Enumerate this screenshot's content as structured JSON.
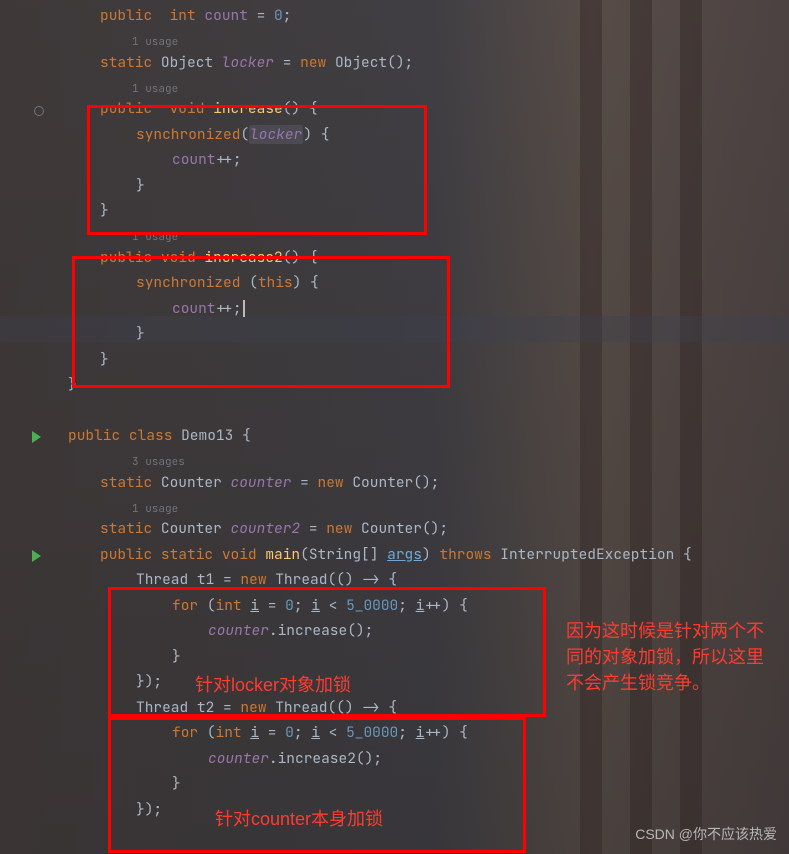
{
  "usages": {
    "one": "1 usage",
    "three": "3 usages"
  },
  "code": {
    "l1": {
      "pub": "public",
      "sp": "  ",
      "int_": "int",
      "count": "count",
      "eq": " = ",
      "zero": "0",
      "semi": ";"
    },
    "l3": {
      "stat": "static",
      "obj": "Object",
      "locker": "locker",
      "eq": " = ",
      "new_": "new",
      "obj2": "Object",
      "paren": "();"
    },
    "l5": {
      "pub": "public",
      "sp": "  ",
      "void_": "void",
      "name": "increase",
      "tail": "() {"
    },
    "l6": {
      "sync": "synchronized",
      "open": "(",
      "locker": "locker",
      "close": ") {"
    },
    "l7": {
      "count": "count",
      "pp": "++",
      "semi": ";"
    },
    "l8": {
      "brace": "}"
    },
    "l9": {
      "brace": "}"
    },
    "l11": {
      "pub": "public",
      "void_": "void",
      "name": "increase2",
      "tail": "() {"
    },
    "l12": {
      "sync": "synchronized",
      "open": " (",
      "this_": "this",
      "close": ") {"
    },
    "l13": {
      "count": "count",
      "pp": "++",
      "semi": ";"
    },
    "l14": {
      "brace": "}"
    },
    "l15": {
      "brace": "}"
    },
    "l16": {
      "brace": "}"
    },
    "l18": {
      "pub": "public",
      "cls": "class",
      "name": "Demo13",
      "tail": " {"
    },
    "l20": {
      "stat": "static",
      "cnt": "Counter",
      "var": "counter",
      "eq": " = ",
      "new_": "new",
      "cnt2": "Counter",
      "tail": "();"
    },
    "l22": {
      "stat": "static",
      "cnt": "Counter",
      "var": "counter2",
      "eq": " = ",
      "new_": "new",
      "cnt2": "Counter",
      "tail": "();"
    },
    "l23": {
      "pub": "public",
      "stat": "static",
      "void_": "void",
      "main": "main",
      "open": "(",
      "str": "String[]",
      "args": "args",
      "close": ")",
      "throws_": "throws",
      "exc": "InterruptedException",
      "tail": " {"
    },
    "l24": {
      "thr": "Thread",
      "t1": "t1",
      "eq": " = ",
      "new_": "new",
      "thr2": "Thread",
      "lam": "(() -> {"
    },
    "l25": {
      "for_": "for",
      "open": " (",
      "int_": "int",
      "i": "i",
      "eq": " = ",
      "zero": "0",
      "semi1": "; ",
      "i2": "i",
      "lt": " < ",
      "lim": "5_0000",
      "semi2": "; ",
      "i3": "i",
      "pp": "++",
      "close": ") {"
    },
    "l26": {
      "ctr": "counter",
      "dot": ".",
      "call": "increase",
      "tail": "();"
    },
    "l27": {
      "brace": "}"
    },
    "l28": {
      "tail": "});"
    },
    "l29": {
      "thr": "Thread",
      "t2": "t2",
      "eq": " = ",
      "new_": "new",
      "thr2": "Thread",
      "lam": "(() -> {"
    },
    "l30": {
      "for_": "for",
      "open": " (",
      "int_": "int",
      "i": "i",
      "eq": " = ",
      "zero": "0",
      "semi1": "; ",
      "i2": "i",
      "lt": " < ",
      "lim": "5_0000",
      "semi2": "; ",
      "i3": "i",
      "pp": "++",
      "close": ") {"
    },
    "l31": {
      "ctr": "counter",
      "dot": ".",
      "call": "increase2",
      "tail": "();"
    },
    "l32": {
      "brace": "}"
    },
    "l33": {
      "tail": "});"
    }
  },
  "annotations": {
    "a1": "针对locker对象加锁",
    "a2": "针对counter本身加锁",
    "side": "因为这时候是针对两个不同的对象加锁，所以这里不会产生锁竞争。"
  },
  "watermark": "CSDN @你不应该热爱",
  "line_number_visible": "8"
}
